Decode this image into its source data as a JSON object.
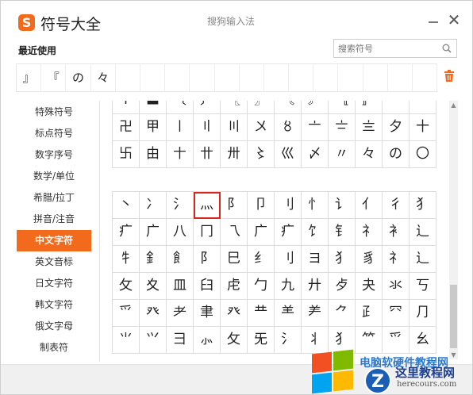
{
  "window": {
    "title": "符号大全",
    "logo_letter": "S",
    "ime_name": "搜狗输入法"
  },
  "recent": {
    "title": "最近使用",
    "symbols": [
      "』",
      "『",
      "の",
      "々",
      "",
      "",
      "",
      "",
      "",
      "",
      "",
      "",
      "",
      "",
      "",
      "",
      ""
    ]
  },
  "search": {
    "placeholder": "搜索符号"
  },
  "sidebar": {
    "items": [
      {
        "label": "特殊符号",
        "active": false
      },
      {
        "label": "标点符号",
        "active": false
      },
      {
        "label": "数字序号",
        "active": false
      },
      {
        "label": "数学/单位",
        "active": false
      },
      {
        "label": "希腊/拉丁",
        "active": false
      },
      {
        "label": "拼音/注音",
        "active": false
      },
      {
        "label": "中文字符",
        "active": true
      },
      {
        "label": "英文音标",
        "active": false
      },
      {
        "label": "日文字符",
        "active": false
      },
      {
        "label": "韩文字符",
        "active": false
      },
      {
        "label": "俄文字母",
        "active": false
      },
      {
        "label": "制表符",
        "active": false
      }
    ]
  },
  "grid1": {
    "rows": [
      [
        "〒",
        "〓",
        "〔",
        "〕",
        "〖",
        "〗",
        "〘",
        "〙",
        "〚",
        "〛",
        "〜",
        "〰"
      ],
      [
        "卍",
        "甲",
        "〡",
        "〢",
        "〣",
        "〤",
        "〥",
        "〦",
        "〧",
        "〨",
        "夕",
        "十"
      ],
      [
        "卐",
        "由",
        "〸",
        "〹",
        "〺",
        "〻",
        "巛",
        "〆",
        "〃",
        "々",
        "の",
        "〇"
      ]
    ]
  },
  "grid2": {
    "rows": [
      [
        "丶",
        "冫",
        "氵",
        "灬",
        "阝",
        "卩",
        "刂",
        "忄",
        "讠",
        "亻",
        "彳",
        "犭"
      ],
      [
        "疒",
        "广",
        "八",
        "冂",
        "乁",
        "广",
        "疒",
        "饣",
        "钅",
        "礻",
        "衤",
        "辶"
      ],
      [
        "牜",
        "釒",
        "飠",
        "阝",
        "巳",
        "纟",
        "刂",
        "ヨ",
        "犭",
        "豸",
        "礻",
        "辶"
      ],
      [
        "攵",
        "夊",
        "皿",
        "臼",
        "虍",
        "勹",
        "九",
        "廾",
        "歺",
        "夬",
        "氺",
        "丂"
      ],
      [
        "爫",
        "癶",
        "耂",
        "聿",
        "癶",
        "龷",
        "⺷",
        "⺶",
        "⺈",
        "⺪",
        "⺳",
        "⺆"
      ],
      [
        "⺌",
        "⺍",
        "⺕",
        "⺗",
        "⺙",
        "⺛",
        "⺡",
        "⺦",
        "⺨",
        "⺮",
        "⺤",
        "⺓"
      ]
    ],
    "selected_symbol": "灬"
  },
  "watermark": {
    "line1": "电脑软硬件教程网",
    "badge": "Z",
    "line2": "这里教程网",
    "line3": "herecours.com"
  },
  "colors": {
    "accent": "#f26a1b",
    "selected_border": "#d8261f"
  }
}
